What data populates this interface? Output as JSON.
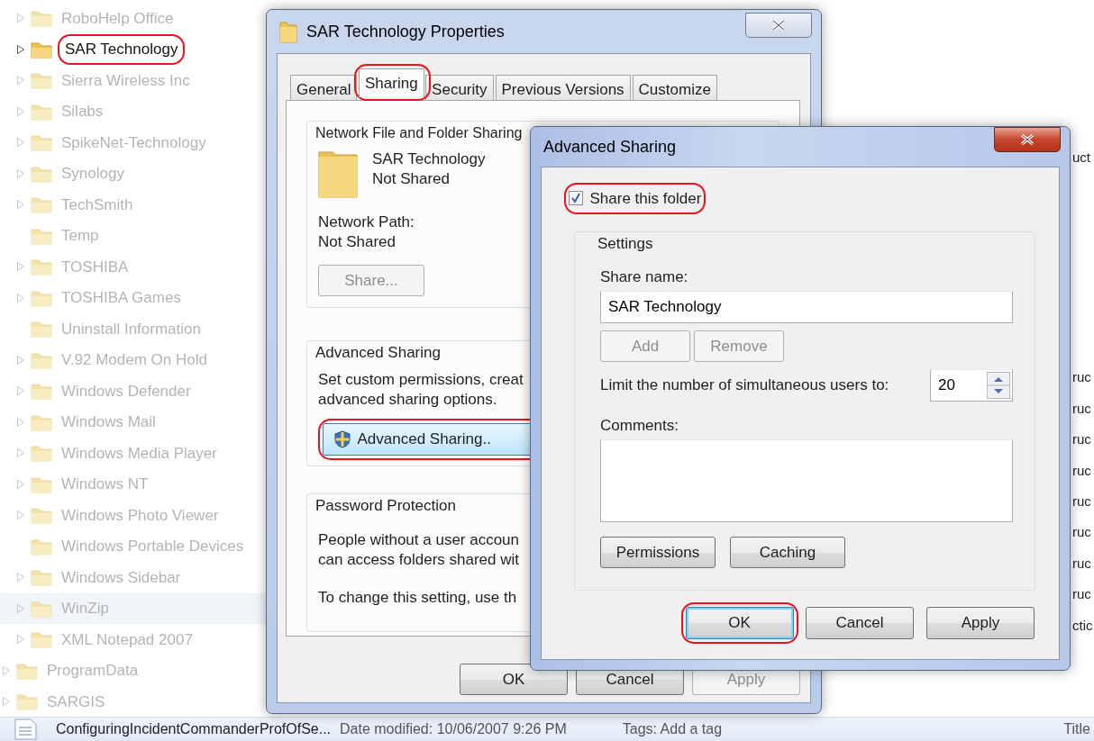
{
  "explorer": {
    "tree": [
      {
        "children": [
          {
            "label": "RoboHelp Office",
            "expandable": true,
            "selected": false,
            "hovered": false,
            "highlighted": false
          },
          {
            "label": "SAR Technology",
            "expandable": true,
            "selected": true,
            "hovered": false,
            "highlighted": true
          },
          {
            "label": "Sierra Wireless Inc",
            "expandable": true,
            "selected": false,
            "hovered": false,
            "highlighted": false
          },
          {
            "label": "Silabs",
            "expandable": true,
            "selected": false,
            "hovered": false,
            "highlighted": false
          },
          {
            "label": "SpikeNet-Technology",
            "expandable": true,
            "selected": false,
            "hovered": false,
            "highlighted": false
          },
          {
            "label": "Synology",
            "expandable": true,
            "selected": false,
            "hovered": false,
            "highlighted": false
          },
          {
            "label": "TechSmith",
            "expandable": true,
            "selected": false,
            "hovered": false,
            "highlighted": false
          },
          {
            "label": "Temp",
            "expandable": false,
            "selected": false,
            "hovered": false,
            "highlighted": false
          },
          {
            "label": "TOSHIBA",
            "expandable": true,
            "selected": false,
            "hovered": false,
            "highlighted": false
          },
          {
            "label": "TOSHIBA Games",
            "expandable": true,
            "selected": false,
            "hovered": false,
            "highlighted": false
          },
          {
            "label": "Uninstall Information",
            "expandable": false,
            "selected": false,
            "hovered": false,
            "highlighted": false
          },
          {
            "label": "V.92 Modem On Hold",
            "expandable": true,
            "selected": false,
            "hovered": false,
            "highlighted": false
          },
          {
            "label": "Windows Defender",
            "expandable": true,
            "selected": false,
            "hovered": false,
            "highlighted": false
          },
          {
            "label": "Windows Mail",
            "expandable": true,
            "selected": false,
            "hovered": false,
            "highlighted": false
          },
          {
            "label": "Windows Media Player",
            "expandable": true,
            "selected": false,
            "hovered": false,
            "highlighted": false
          },
          {
            "label": "Windows NT",
            "expandable": true,
            "selected": false,
            "hovered": false,
            "highlighted": false
          },
          {
            "label": "Windows Photo Viewer",
            "expandable": true,
            "selected": false,
            "hovered": false,
            "highlighted": false
          },
          {
            "label": "Windows Portable Devices",
            "expandable": false,
            "selected": false,
            "hovered": false,
            "highlighted": false
          },
          {
            "label": "Windows Sidebar",
            "expandable": true,
            "selected": false,
            "hovered": false,
            "highlighted": false
          },
          {
            "label": "WinZip",
            "expandable": true,
            "selected": false,
            "hovered": true,
            "highlighted": false
          },
          {
            "label": "XML Notepad 2007",
            "expandable": true,
            "selected": false,
            "hovered": false,
            "highlighted": false
          }
        ]
      },
      {
        "label": "ProgramData",
        "expandable": true,
        "selected": false,
        "hovered": false,
        "highlighted": false
      },
      {
        "label": "SARGIS",
        "expandable": true,
        "selected": false,
        "hovered": false,
        "highlighted": false
      }
    ],
    "right_fragments": [
      "uct",
      "ruc",
      "ruc",
      "ruc",
      "ruc",
      "ruc",
      "ruc",
      "ruc",
      "ruc",
      "ctic"
    ],
    "details": {
      "file_name": "ConfiguringIncidentCommanderProfOfSe...",
      "date_modified": "Date modified: 10/06/2007 9:26 PM",
      "tags": "Tags: Add a tag",
      "title": "Title"
    }
  },
  "properties_dialog": {
    "title": "SAR Technology Properties",
    "tabs": [
      {
        "label": "General",
        "selected": false,
        "highlighted": false
      },
      {
        "label": "Sharing",
        "selected": true,
        "highlighted": true
      },
      {
        "label": "Security",
        "selected": false,
        "highlighted": false
      },
      {
        "label": "Previous Versions",
        "selected": false,
        "highlighted": false
      },
      {
        "label": "Customize",
        "selected": false,
        "highlighted": false
      }
    ],
    "network_sharing": {
      "legend": "Network File and Folder Sharing",
      "name": "SAR Technology",
      "status": "Not Shared",
      "path_label": "Network Path:",
      "path": "Not Shared",
      "share_button": {
        "label": "Share...",
        "disabled": true
      }
    },
    "advanced_sharing": {
      "legend": "Advanced Sharing",
      "text_lines": [
        "Set custom permissions, creat",
        "advanced sharing options."
      ],
      "button": {
        "label": "Advanced Sharing..",
        "highlighted": true
      }
    },
    "password_protection": {
      "legend": "Password Protection",
      "text_lines": [
        "People without a user accoun",
        "can access folders shared wit"
      ],
      "note": "To change this setting, use th"
    },
    "buttons": [
      {
        "label": "OK",
        "disabled": false
      },
      {
        "label": "Cancel",
        "disabled": false
      },
      {
        "label": "Apply",
        "disabled": true
      }
    ]
  },
  "advanced_sharing_dialog": {
    "title": "Advanced Sharing",
    "share_checkbox": {
      "label": "Share this folder",
      "checked": true,
      "highlighted": true
    },
    "settings": {
      "legend": "Settings",
      "share_name_label": "Share name:",
      "share_name": "SAR Technology",
      "name_buttons": [
        {
          "label": "Add",
          "disabled": true
        },
        {
          "label": "Remove",
          "disabled": true
        }
      ],
      "limit_label": "Limit the number of simultaneous users to:",
      "limit_value": "20",
      "comments_label": "Comments:",
      "buttons": [
        {
          "label": "Permissions",
          "disabled": false
        },
        {
          "label": "Caching",
          "disabled": false
        }
      ]
    },
    "buttons": [
      {
        "label": "OK",
        "default": true,
        "highlighted": true
      },
      {
        "label": "Cancel",
        "default": false,
        "highlighted": false
      },
      {
        "label": "Apply",
        "default": false,
        "highlighted": false
      }
    ]
  }
}
